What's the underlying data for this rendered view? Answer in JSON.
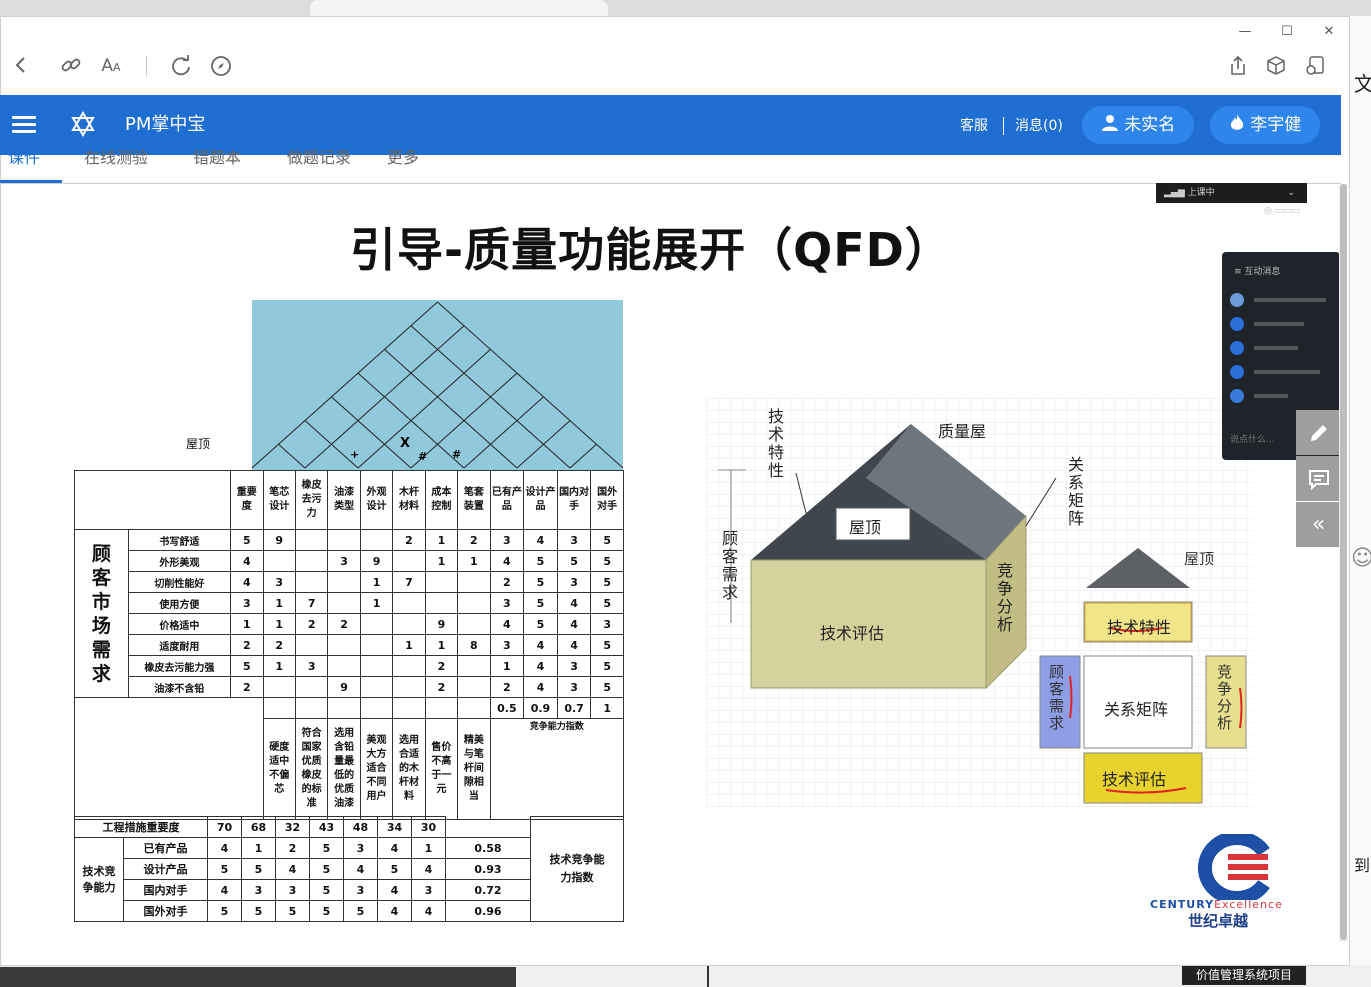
{
  "browser": {
    "toolbar_icons": [
      "back-icon",
      "link-icon",
      "text-size-icon",
      "refresh-icon",
      "compass-icon"
    ],
    "right_icons": [
      "share-icon",
      "cube-icon",
      "screen-lock-icon"
    ],
    "window_controls": [
      "—",
      "☐",
      "✕"
    ],
    "behind_text_1": "文",
    "behind_text_2": "到",
    "bottom_tag": "价值管理系统项目"
  },
  "app": {
    "title": "PM掌中宝",
    "service": "客服",
    "messages": "消息(0)",
    "unverified": "未实名",
    "user": "李宇健",
    "tabs": [
      "课件",
      "在线测验",
      "错题本",
      "做题记录",
      "更多"
    ]
  },
  "slide": {
    "title": "引导-质量功能展开（QFD）",
    "roof_label": "屋顶",
    "roof_marks": [
      "X",
      "#",
      "#",
      "+"
    ],
    "header_row": [
      "重要度",
      "笔芯设计",
      "橡皮去污力",
      "油漆类型",
      "外观设计",
      "木杆材料",
      "成本控制",
      "笔套装置",
      "已有产品",
      "设计产品",
      "国内对手",
      "国外对手"
    ],
    "group_label": "顾客市场需求",
    "rows": [
      {
        "need": "书写舒适",
        "imp": "5",
        "v": [
          "9",
          "",
          "",
          "",
          "2",
          "1",
          "2"
        ],
        "c": [
          "3",
          "4",
          "3",
          "5"
        ]
      },
      {
        "need": "外形美观",
        "imp": "4",
        "v": [
          "",
          "",
          "3",
          "9",
          "",
          "1",
          "1"
        ],
        "c": [
          "4",
          "5",
          "5",
          "5"
        ]
      },
      {
        "need": "切削性能好",
        "imp": "4",
        "v": [
          "3",
          "",
          "",
          "1",
          "7",
          "",
          ""
        ],
        "c": [
          "2",
          "5",
          "3",
          "5"
        ]
      },
      {
        "need": "使用方便",
        "imp": "3",
        "v": [
          "1",
          "7",
          "",
          "1",
          "",
          "",
          ""
        ],
        "c": [
          "3",
          "5",
          "4",
          "5"
        ]
      },
      {
        "need": "价格适中",
        "imp": "1",
        "v": [
          "1",
          "2",
          "2",
          "",
          "",
          "9",
          ""
        ],
        "c": [
          "4",
          "5",
          "4",
          "3"
        ]
      },
      {
        "need": "适度耐用",
        "imp": "2",
        "v": [
          "2",
          "",
          "",
          "",
          "1",
          "1",
          "8"
        ],
        "c": [
          "3",
          "4",
          "4",
          "5"
        ]
      },
      {
        "need": "橡皮去污能力强",
        "imp": "5",
        "v": [
          "1",
          "3",
          "",
          "",
          "",
          "2",
          ""
        ],
        "c": [
          "1",
          "4",
          "3",
          "5"
        ]
      },
      {
        "need": "油漆不含铅",
        "imp": "2",
        "v": [
          "",
          "",
          "9",
          "",
          "",
          "2",
          ""
        ],
        "c": [
          "2",
          "4",
          "3",
          "5"
        ]
      }
    ],
    "competitive_index": [
      "0.5",
      "0.9",
      "0.7",
      "1"
    ],
    "competitive_index_label": "竞争能力指数",
    "targets": [
      "硬度适中不偏芯",
      "符合国家优质橡皮的标准",
      "选用含铅量最低的优质油漆",
      "美观大方适合不同用户",
      "选用合适的木杆材料",
      "售价不高于一元",
      "精美与笔杆间隙相当"
    ],
    "importance_label": "工程措施重要度",
    "importance": [
      "70",
      "68",
      "32",
      "43",
      "48",
      "34",
      "30"
    ],
    "tech_group_label": "技术竞争能力",
    "tech_rows": [
      {
        "name": "已有产品",
        "v": [
          "4",
          "1",
          "2",
          "5",
          "3",
          "4",
          "1"
        ],
        "idx": "0.58"
      },
      {
        "name": "设计产品",
        "v": [
          "5",
          "5",
          "4",
          "5",
          "4",
          "5",
          "4"
        ],
        "idx": "0.93"
      },
      {
        "name": "国内对手",
        "v": [
          "4",
          "3",
          "3",
          "5",
          "3",
          "4",
          "3"
        ],
        "idx": "0.72"
      },
      {
        "name": "国外对手",
        "v": [
          "5",
          "5",
          "5",
          "5",
          "5",
          "4",
          "4"
        ],
        "idx": "0.96"
      }
    ],
    "tech_index_label": "技术竞争能力指数",
    "house": {
      "tech_char": "技术特性",
      "quality_house": "质量屋",
      "relation_matrix": "关系矩阵",
      "roof": "屋顶",
      "customer_needs": "顾客需求",
      "tech_eval": "技术评估",
      "competition": "竞争分析"
    },
    "small_house": {
      "roof": "屋顶",
      "tech_char": "技术特性",
      "customer_needs": "顾客需求",
      "relation_matrix": "关系矩阵",
      "competition": "竞争分析",
      "tech_eval": "技术评估"
    },
    "logo": {
      "line1": "CENTURY",
      "line2": "Excellence",
      "line3": "世纪卓越"
    },
    "chat_title": "互动消息",
    "chat_input": "说点什么...",
    "live_status": "上课中"
  }
}
